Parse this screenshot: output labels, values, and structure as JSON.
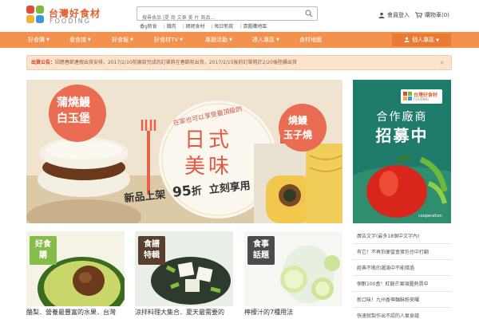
{
  "brand": {
    "title": "台灣好食材",
    "subtitle": "FOODING",
    "colors": {
      "orange": "#e0612f",
      "nav": "#f2924e",
      "green": "#7dbb3b",
      "red": "#e34a3a",
      "yellow": "#f3b332",
      "blue": "#3a9ad9"
    }
  },
  "search": {
    "placeholder": "搜尋食品 |提 商 文章 美 片 商品...",
    "icon": "search-icon"
  },
  "hot_keywords": [
    "香g新食",
    "鐵肉",
    "絕絕食材",
    "每日新款",
    "清醬購地區"
  ],
  "util": {
    "login": "會員登入",
    "cart": "購物車(0)"
  },
  "nav": {
    "items": [
      "好食購",
      "看食譜",
      "好食報",
      "好食材TV",
      "專題活動",
      "達人專區",
      "食材地圖"
    ],
    "member": "個人專區"
  },
  "notice": {
    "label": "出貨公告：",
    "text": "因應春節連假出貨安排，2017/2/10前廠款完成的訂單將在春節前出貨，2017/2/15後的訂單將於2/20後陸續出貨",
    "close": "×"
  },
  "hero": {
    "badge_left_1": "蒲燒鰻",
    "badge_left_2": "白玉堡",
    "arc_text": "在家也可以享受最頂級的",
    "main_1": "日式",
    "main_2": "美味",
    "badge_right_1": "燒鰻",
    "badge_right_2": "玉子燒",
    "promo_a": "新品上架",
    "promo_b": "95",
    "promo_c": "折",
    "promo_d": "立刻享用"
  },
  "ad": {
    "logo": "台灣好食材",
    "logo_sub": "FOODING",
    "line1": "合作廠商",
    "line2": "招募中",
    "footer": "cooperation"
  },
  "cards": [
    {
      "tag1": "好食",
      "tag2": "購",
      "caption": "酪梨．營養最豐富的水果．台灣"
    },
    {
      "tag1": "食譜",
      "tag2": "特輯",
      "caption": "涼拌料理大集合．夏天最需要的"
    },
    {
      "tag1": "食事",
      "tag2": "話題",
      "caption": "檸檬汁的7種用法"
    }
  ],
  "side_list": [
    "廣告文字(最多18個中文字內)",
    "有它！不再怕便當盒蛋包也中打翻",
    "經典不敗的灑滿中不能錯過",
    "側數100盒！紅龍芒果項圖熱賣中",
    "新口味！九州香檸麵酥粉來囉",
    "快速就製作出不認的人氣食譜"
  ]
}
